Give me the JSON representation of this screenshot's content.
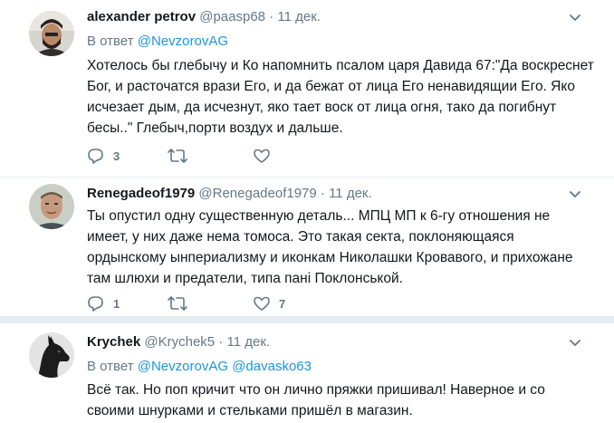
{
  "tweets": [
    {
      "name": "alexander petrov",
      "handle": "@paasp68",
      "separator": "·",
      "date": "11 дек.",
      "reply_prefix": "В ответ",
      "reply_to": [
        "@NevzorovAG"
      ],
      "text": "Хотелось бы глебычу и Ко напомнить псалом царя Давида 67:\"Да воскреснет Бог, и расточатся врази Его, и да бежат от лица Его ненавидящии Его. Яко исчезает дым, да исчезнут, яко тает воск от лица огня, тако да погибнут бесы..\" Глебыч,порти воздух и дальше.",
      "replies": "3",
      "retweets": "",
      "likes": ""
    },
    {
      "name": "Renegadeof1979",
      "handle": "@Renegadeof1979",
      "separator": "·",
      "date": "11 дек.",
      "text": "Ты опустил одну существенную деталь... МПЦ МП к 6-гу отношения не имеет, у них даже нема томоса. Это такая секта, поклоняющаяся ордынскому ынпериализму и иконкам Николашки Кровавого, и прихожане там шлюхи и предатели, типа пані Поклонськой.",
      "replies": "1",
      "retweets": "",
      "likes": "7"
    },
    {
      "name": "Krychek",
      "handle": "@Krychek5",
      "separator": "·",
      "date": "11 дек.",
      "reply_prefix": "В ответ",
      "reply_to": [
        "@NevzorovAG",
        "@davasko63"
      ],
      "text": "Всё так. Но поп кричит что он лично пряжки пришивал! Наверное и со своими шнурками и стельками пришёл в магазин."
    }
  ],
  "colors": {
    "link": "#1b95e0",
    "muted": "#657786",
    "text": "#14171a",
    "divider": "#e6ecf0"
  },
  "icons": [
    "reply-icon",
    "retweet-icon",
    "like-icon",
    "caret-down-icon"
  ]
}
